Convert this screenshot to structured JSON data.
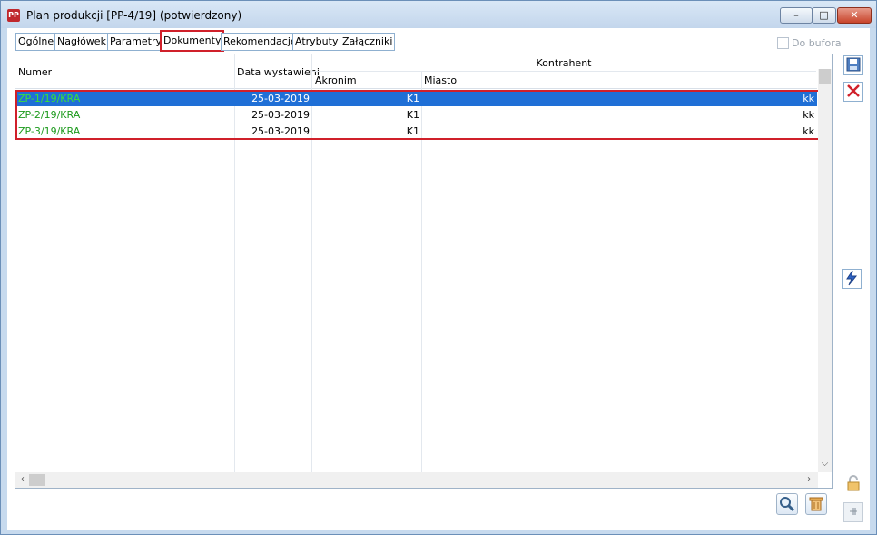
{
  "window": {
    "title": "Plan produkcji [PP-4/19]  (potwierdzony)",
    "icon": "PP",
    "controls": {
      "minimize": "–",
      "maximize": "□",
      "close": "✕"
    }
  },
  "tabs": [
    {
      "label": "Ogólne"
    },
    {
      "label": "Nagłówek"
    },
    {
      "label": "Parametry"
    },
    {
      "label": "Dokumenty",
      "active": true
    },
    {
      "label": "Rekomendacje"
    },
    {
      "label": "Atrybuty"
    },
    {
      "label": "Załączniki"
    }
  ],
  "buffer_checkbox": {
    "label": "Do bufora",
    "checked": false
  },
  "grid": {
    "columns": {
      "numer": "Numer",
      "data": "Data wystawieni",
      "kontrahent": "Kontrahent",
      "akronim": "Akronim",
      "miasto": "Miasto"
    },
    "rows": [
      {
        "numer": "ZP-1/19/KRA",
        "data": "25-03-2019",
        "akronim": "K1",
        "miasto": "kk",
        "selected": true
      },
      {
        "numer": "ZP-2/19/KRA",
        "data": "25-03-2019",
        "akronim": "K1",
        "miasto": "kk",
        "selected": false
      },
      {
        "numer": "ZP-3/19/KRA",
        "data": "25-03-2019",
        "akronim": "K1",
        "miasto": "kk",
        "selected": false
      }
    ]
  },
  "icons": {
    "save": "save-icon",
    "delete": "delete-icon",
    "run": "lightning-icon",
    "search": "magnifier-icon",
    "trash": "trash-icon",
    "lock": "lock-icon",
    "pin": "pin-icon"
  },
  "colors": {
    "accent": "#1f6fd6",
    "highlight": "#d0202a",
    "document_number": "#1c9a1c"
  }
}
